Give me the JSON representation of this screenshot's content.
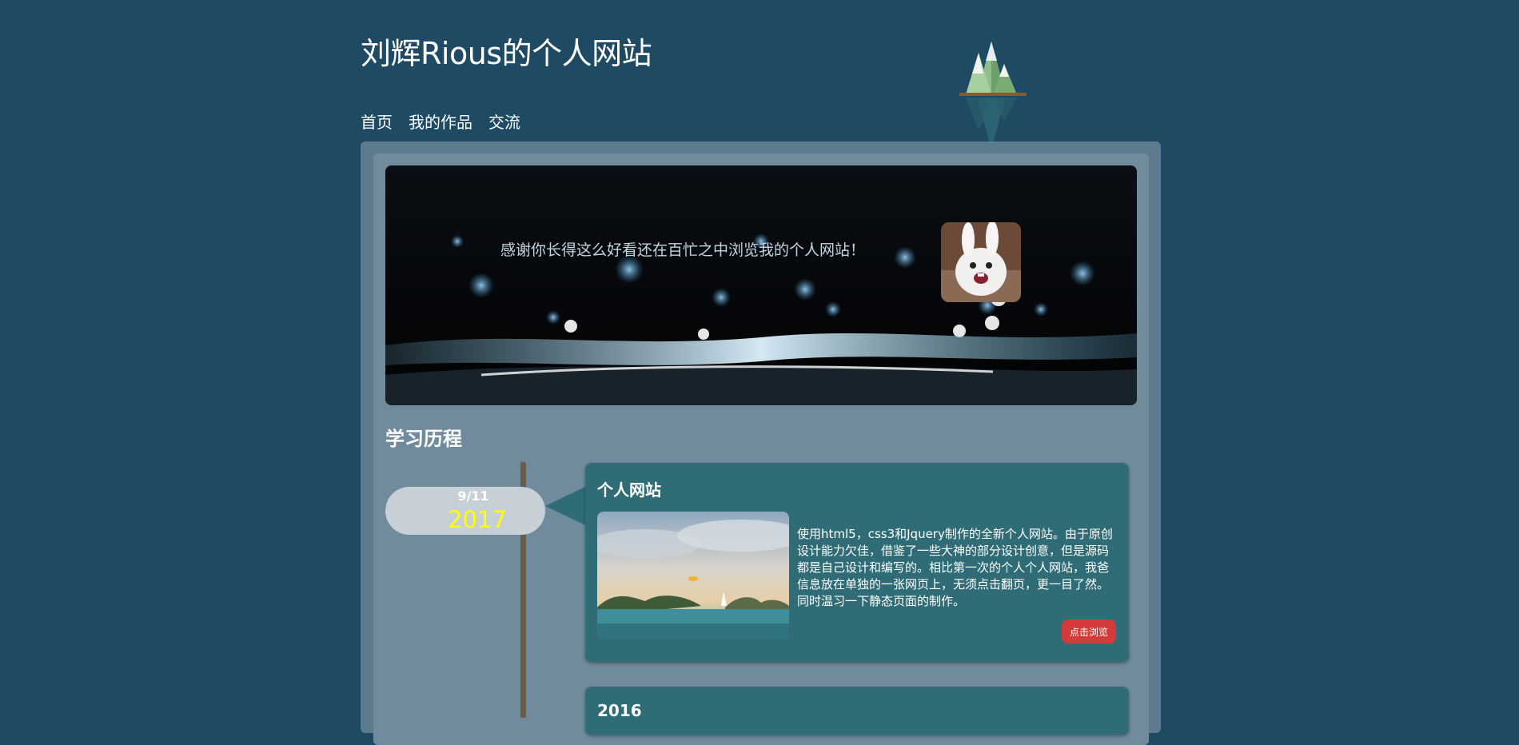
{
  "site": {
    "title": "刘辉Rious的个人网站"
  },
  "nav": {
    "items": [
      {
        "label": "首页"
      },
      {
        "label": "我的作品"
      },
      {
        "label": "交流"
      }
    ]
  },
  "banner": {
    "text": "感谢你长得这么好看还在百忙之中浏览我的个人网站！"
  },
  "section": {
    "title": "学习历程"
  },
  "timeline": {
    "entries": [
      {
        "date_day": "9/11",
        "date_year": "2017",
        "title": "个人网站",
        "description": "使用html5，css3和Jquery制作的全新个人网站。由于原创设计能力欠佳，借鉴了一些大神的部分设计创意，但是源码都是自己设计和编写的。相比第一次的个人个人网站，我爸信息放在单独的一张网页上，无须点击翻页，更一目了然。同时温习一下静态页面的制作。",
        "button_label": "点击浏览"
      },
      {
        "title": "2016"
      }
    ]
  },
  "colors": {
    "page_bg": "#1f4a63",
    "panel_outer": "#5d7b8e",
    "panel_inner": "#6f8b9c",
    "card_bg": "#306c76",
    "year_color": "#ffff00",
    "button_bg": "#d33b3b",
    "timeline_line": "#6d5c45"
  },
  "icons": {
    "logo": "mountain-logo-icon",
    "avatar": "rabbit-avatar-image"
  }
}
